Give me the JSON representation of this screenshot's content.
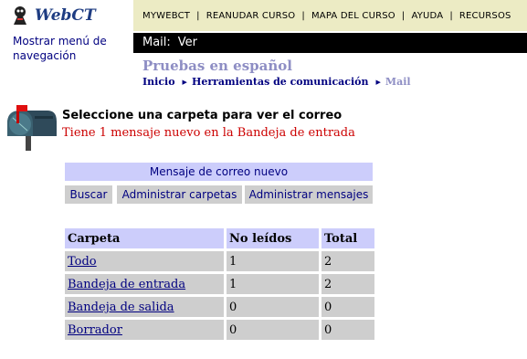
{
  "logo": {
    "text": "WebCT"
  },
  "topnav": {
    "items": [
      "MYWEBCT",
      "REANUDAR CURSO",
      "MAPA DEL CURSO",
      "AYUDA",
      "RECURSOS"
    ],
    "separator": "|"
  },
  "leftnav": {
    "label": "Mostrar menú de navegación"
  },
  "titlebar": {
    "section": "Mail:",
    "view": "Ver"
  },
  "course": {
    "title": "Pruebas en español"
  },
  "breadcrumb": {
    "items": [
      "Inicio",
      "Herramientas de comunicación"
    ],
    "current": "Mail"
  },
  "main": {
    "heading": "Seleccione una carpeta para ver el correo",
    "new_message_notice": "Tiene 1 mensaje nuevo en la Bandeja de entrada"
  },
  "actions": {
    "compose": "Mensaje de correo nuevo",
    "search": "Buscar",
    "manage_folders": "Administrar carpetas",
    "manage_messages": "Administrar mensajes"
  },
  "folders": {
    "headers": [
      "Carpeta",
      "No leídos",
      "Total"
    ],
    "rows": [
      {
        "name": "Todo",
        "unread": "1",
        "total": "2"
      },
      {
        "name": "Bandeja de entrada",
        "unread": "1",
        "total": "2"
      },
      {
        "name": "Bandeja de salida",
        "unread": "0",
        "total": "0"
      },
      {
        "name": "Borrador",
        "unread": "0",
        "total": "0"
      }
    ]
  },
  "colors": {
    "topnav_bg": "#ecebc4",
    "titlebar_bg": "#000000",
    "link_navy": "#000080",
    "course_title": "#8e8ec4",
    "alert_red": "#cc0000",
    "header_lavender": "#cccdfb",
    "cell_gray": "#cecece"
  }
}
